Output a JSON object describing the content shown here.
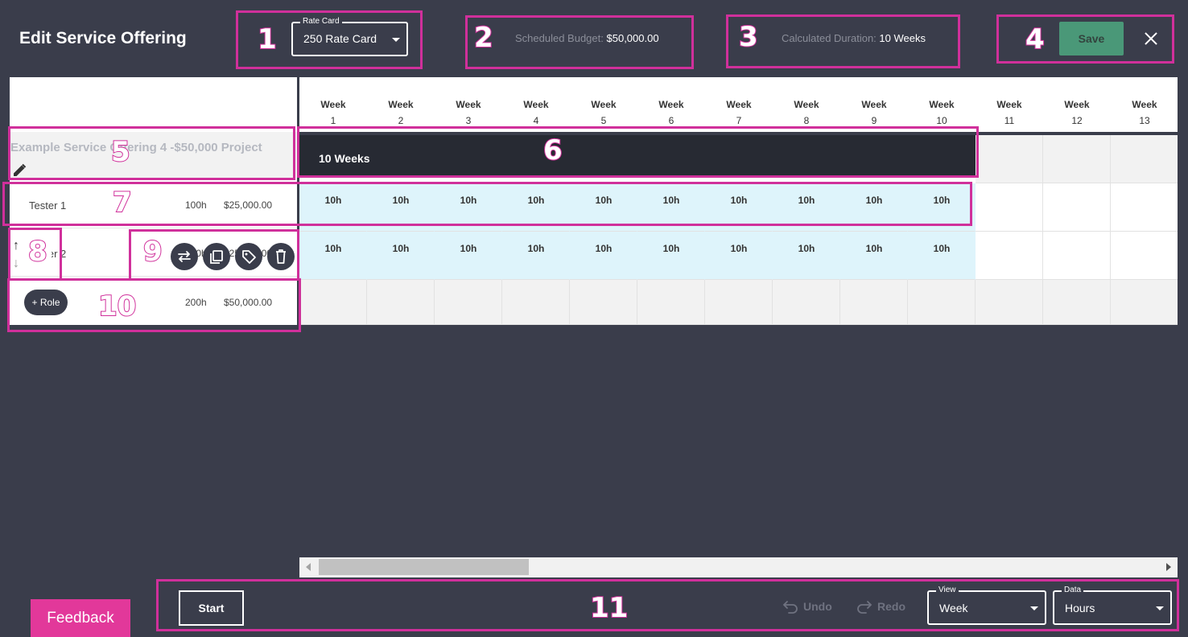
{
  "header": {
    "title": "Edit Service Offering",
    "rate_card": {
      "legend": "Rate Card",
      "value": "250 Rate Card"
    },
    "scheduled_budget": {
      "label": "Scheduled Budget:",
      "value": "$50,000.00"
    },
    "calculated_duration": {
      "label": "Calculated Duration:",
      "value": "10 Weeks"
    },
    "save_label": "Save"
  },
  "weeks": [
    {
      "label": "Week",
      "num": "1"
    },
    {
      "label": "Week",
      "num": "2"
    },
    {
      "label": "Week",
      "num": "3"
    },
    {
      "label": "Week",
      "num": "4"
    },
    {
      "label": "Week",
      "num": "5"
    },
    {
      "label": "Week",
      "num": "6"
    },
    {
      "label": "Week",
      "num": "7"
    },
    {
      "label": "Week",
      "num": "8"
    },
    {
      "label": "Week",
      "num": "9"
    },
    {
      "label": "Week",
      "num": "10"
    },
    {
      "label": "Week",
      "num": "11"
    },
    {
      "label": "Week",
      "num": "12"
    },
    {
      "label": "Week",
      "num": "13"
    }
  ],
  "service_offering": {
    "name": "Example Service Offering 4 -$50,000 Project",
    "duration_bar": "10 Weeks"
  },
  "roles": [
    {
      "name": "Tester 1",
      "hours": "100h",
      "cost": "$25,000.00",
      "weekly": [
        "10h",
        "10h",
        "10h",
        "10h",
        "10h",
        "10h",
        "10h",
        "10h",
        "10h",
        "10h"
      ]
    },
    {
      "name": "Tester 2",
      "hours": "100h",
      "cost": "$25,000.00",
      "weekly": [
        "10h",
        "10h",
        "10h",
        "10h",
        "10h",
        "10h",
        "10h",
        "10h",
        "10h",
        "10h"
      ]
    }
  ],
  "totals": {
    "add_role_label": "+ Role",
    "hours": "200h",
    "cost": "$50,000.00"
  },
  "footer": {
    "feedback_label": "Feedback",
    "start_label": "Start",
    "undo_label": "Undo",
    "redo_label": "Redo",
    "view": {
      "legend": "View",
      "value": "Week"
    },
    "data": {
      "legend": "Data",
      "value": "Hours"
    }
  },
  "annotations": [
    "1",
    "2",
    "3",
    "4",
    "5",
    "6",
    "7",
    "8",
    "9",
    "10",
    "11"
  ],
  "colors": {
    "background": "#3a3d4b",
    "annotation": "#d0309b",
    "save": "#4a9878",
    "allocation": "#def4fb",
    "feedback": "#e2389a"
  }
}
